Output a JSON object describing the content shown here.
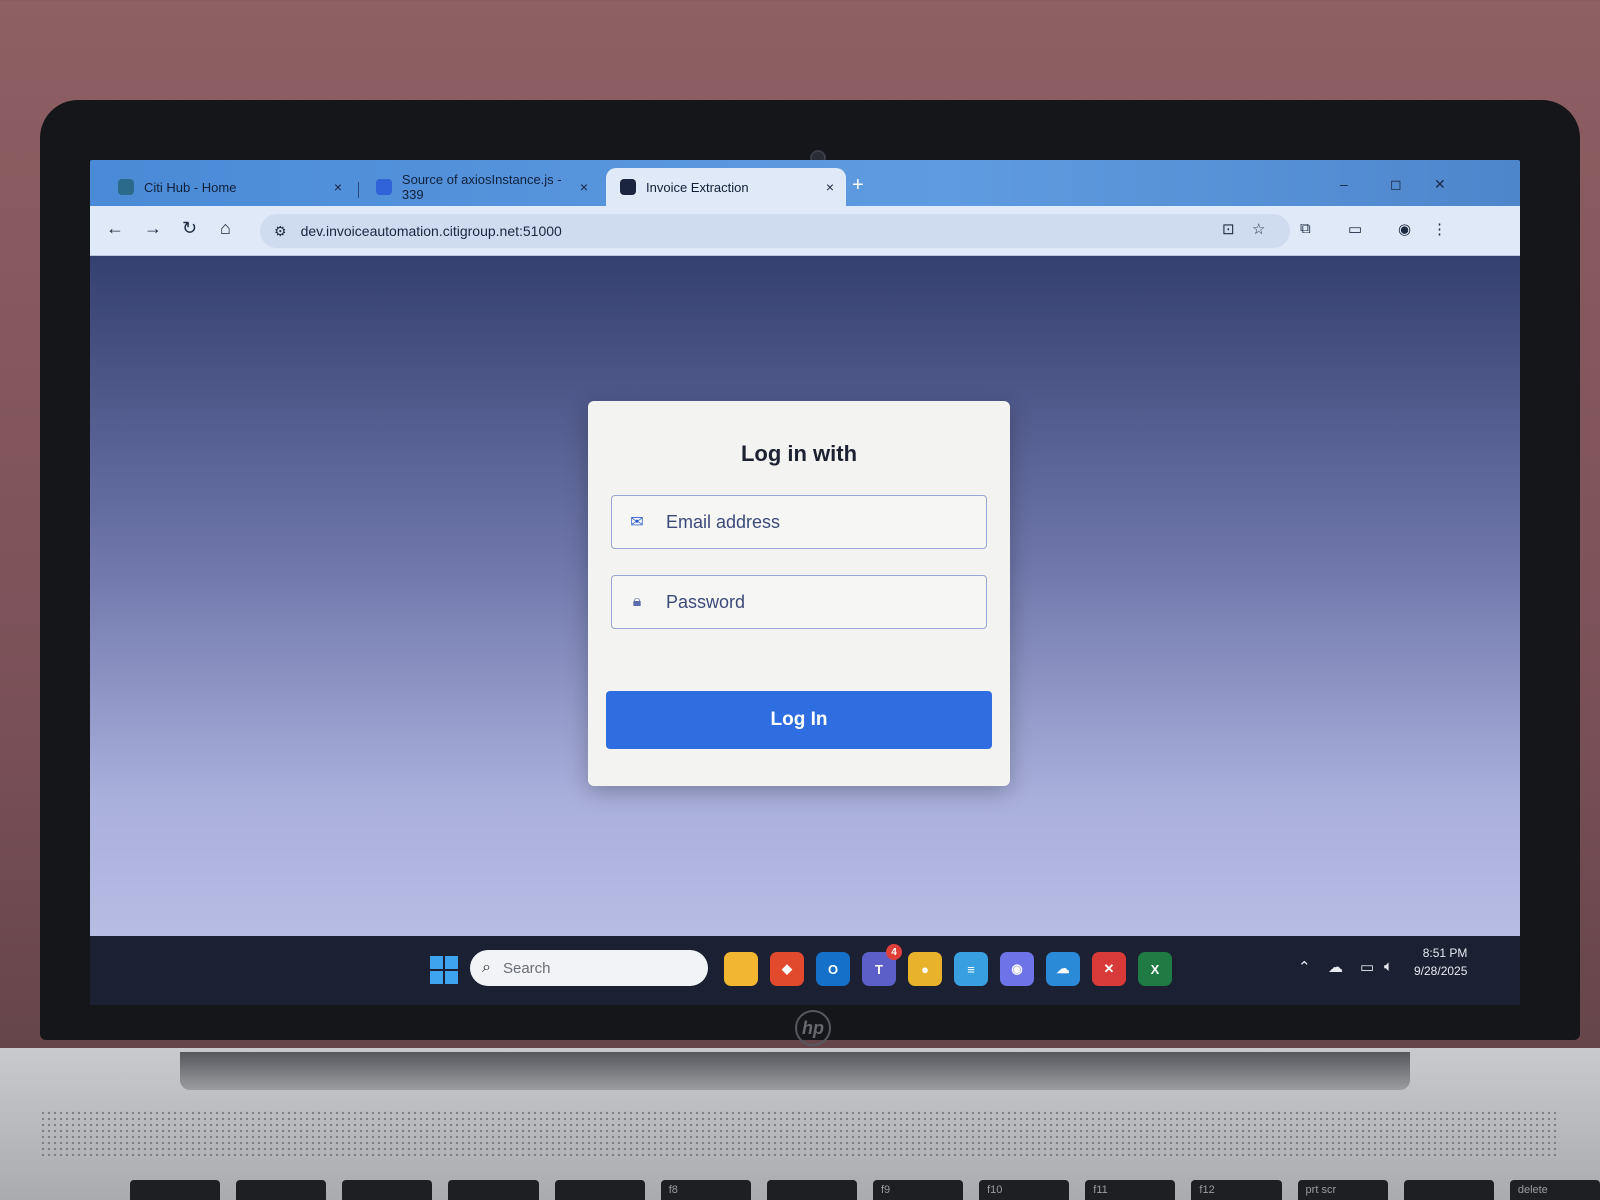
{
  "browser": {
    "tabs": [
      {
        "label": "Citi Hub - Home",
        "icon": "sharepoint-icon",
        "icon_color": "#2b6a8a"
      },
      {
        "label": "Source of axiosInstance.js - 339",
        "icon": "shield-icon",
        "icon_color": "#2f62d8"
      },
      {
        "label": "Invoice Extraction",
        "icon": "app-icon",
        "icon_color": "#1c2540"
      }
    ],
    "active_tab": 2,
    "close_glyph": "×",
    "new_tab_glyph": "+",
    "url": "dev.invoiceautomation.citigroup.net:51000",
    "nav": {
      "back": "←",
      "forward": "→",
      "reload": "↻",
      "home": "⌂"
    },
    "window_controls": {
      "minimize": "–",
      "maximize": "◻",
      "close": "✕"
    }
  },
  "login": {
    "title": "Log in with",
    "email_placeholder": "Email address",
    "password_placeholder": "Password",
    "submit_label": "Log In",
    "accent_color": "#2f6ee0"
  },
  "taskbar": {
    "search_placeholder": "Search",
    "apps": [
      {
        "name": "file-explorer-icon",
        "label": "",
        "color": "#f2b630"
      },
      {
        "name": "git-icon",
        "label": "◆",
        "color": "#e24a2d"
      },
      {
        "name": "outlook-icon",
        "label": "O",
        "color": "#1470c8"
      },
      {
        "name": "teams-icon",
        "label": "T",
        "color": "#5b5fc7",
        "badge": "4"
      },
      {
        "name": "chrome-icon",
        "label": "●",
        "color": "#e8b32a"
      },
      {
        "name": "notepad-icon",
        "label": "≡",
        "color": "#39a0e0"
      },
      {
        "name": "github-icon",
        "label": "◉",
        "color": "#6e73e8"
      },
      {
        "name": "cloud-app-icon",
        "label": "☁",
        "color": "#2b8ad8"
      },
      {
        "name": "error-app-icon",
        "label": "✕",
        "color": "#d83a3a"
      },
      {
        "name": "excel-icon",
        "label": "X",
        "color": "#1f7a44"
      }
    ],
    "time": "8:51 PM",
    "date": "9/28/2025"
  },
  "keyboard": {
    "keys": [
      "",
      "",
      "",
      "",
      "",
      "f8",
      "",
      "f9",
      "f10",
      "f11",
      "f12",
      "prt scr",
      "",
      "delete"
    ]
  }
}
